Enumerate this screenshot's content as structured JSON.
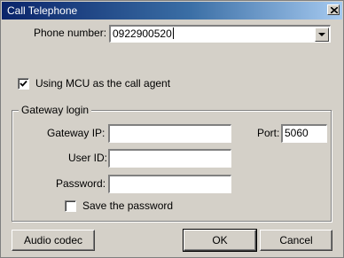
{
  "window": {
    "title": "Call Telephone",
    "close_icon": "close-icon"
  },
  "phone": {
    "label": "Phone number:",
    "value": "0922900520"
  },
  "mcu": {
    "label": "Using MCU as the call agent",
    "checked": true
  },
  "gateway": {
    "group_title": "Gateway login",
    "ip_label": "Gateway IP:",
    "ip_value": "",
    "port_label": "Port:",
    "port_value": "5060",
    "user_label": "User ID:",
    "user_value": "",
    "password_label": "Password:",
    "password_value": "",
    "save_label": "Save the password",
    "save_checked": false
  },
  "buttons": {
    "audio_codec": "Audio codec",
    "ok": "OK",
    "cancel": "Cancel"
  }
}
